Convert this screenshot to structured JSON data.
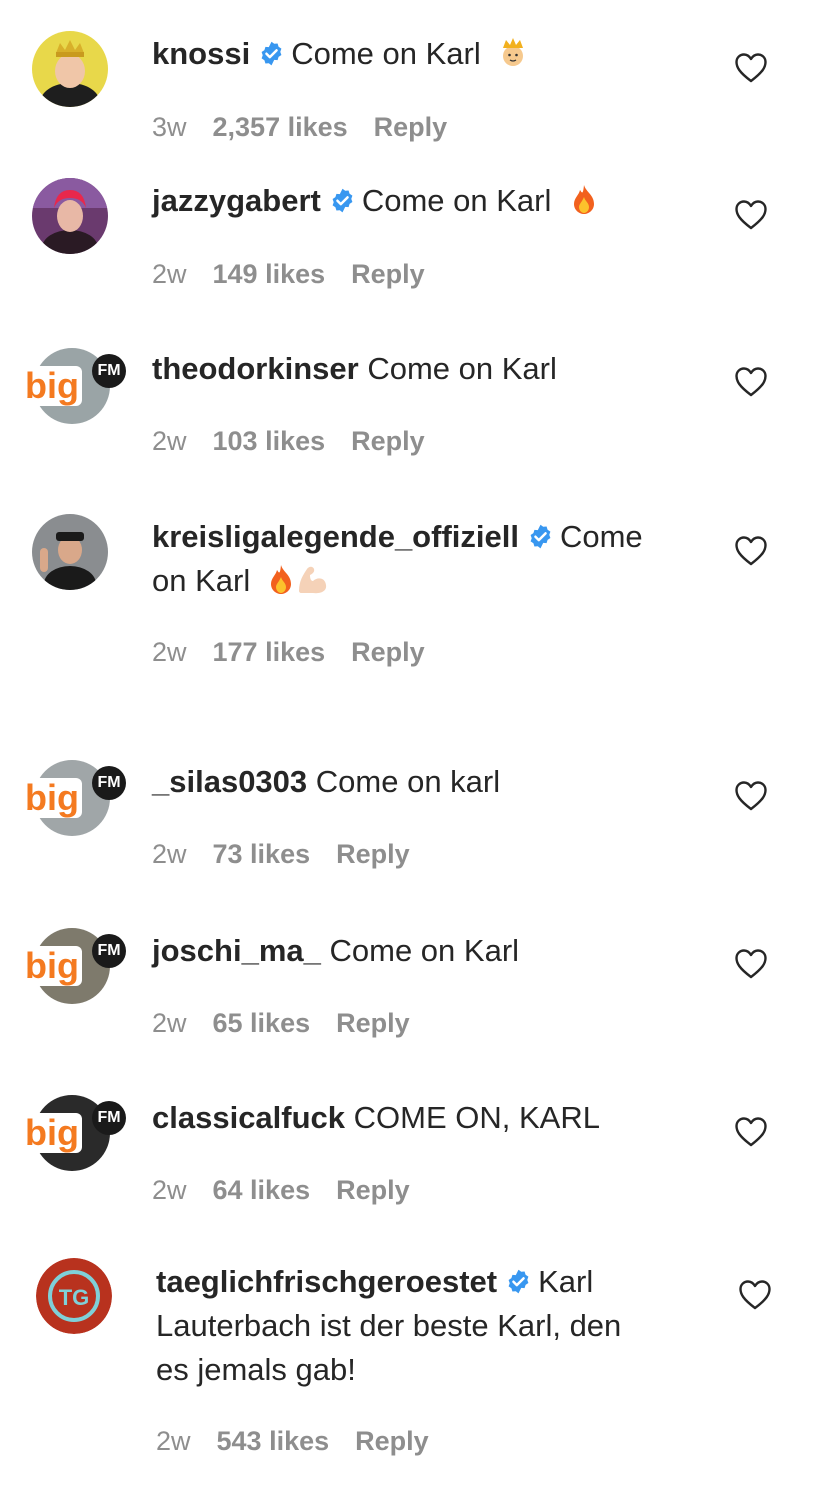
{
  "comments": [
    {
      "username": "knossi",
      "text": "Come on Karl",
      "age": "3w",
      "likes": "2,357 likes",
      "reply": "Reply",
      "verified": true,
      "emoji": "crown-face-emoji",
      "avatar": "avatar-knossi"
    },
    {
      "username": "jazzygabert",
      "text": "Come on Karl",
      "age": "2w",
      "likes": "149 likes",
      "reply": "Reply",
      "verified": true,
      "emoji": "fire-emoji",
      "avatar": "avatar-jazzygabert"
    },
    {
      "username": "theodorkinser",
      "text": "Come on Karl",
      "age": "2w",
      "likes": "103 likes",
      "reply": "Reply",
      "verified": false,
      "avatar": "avatar-bigfm"
    },
    {
      "username": "kreisligalegende_offiziell",
      "text_line1": "Come",
      "text_line2": "on Karl",
      "age": "2w",
      "likes": "177 likes",
      "reply": "Reply",
      "verified": true,
      "emoji": "fire-and-flexed-biceps-emoji",
      "avatar": "avatar-kreisligalegende"
    },
    {
      "username": "_silas0303",
      "text": "Come on karl",
      "age": "2w",
      "likes": "73 likes",
      "reply": "Reply",
      "verified": false,
      "avatar": "avatar-bigfm"
    },
    {
      "username": "joschi_ma_",
      "text": "Come on Karl",
      "age": "2w",
      "likes": "65 likes",
      "reply": "Reply",
      "verified": false,
      "avatar": "avatar-bigfm"
    },
    {
      "username": "classicalfuck",
      "text": "COME ON, KARL",
      "age": "2w",
      "likes": "64 likes",
      "reply": "Reply",
      "verified": false,
      "avatar": "avatar-bigfm"
    },
    {
      "username": "taeglichfrischgeroestet",
      "text_line1": "Karl",
      "text_line2": "Lauterbach ist der beste Karl, den",
      "text_line3": "es jemals gab!",
      "age": "2w",
      "likes": "543 likes",
      "reply": "Reply",
      "verified": true,
      "avatar": "avatar-tfg",
      "avatar_text": "TG"
    }
  ],
  "icons": {
    "like": "heart-outline-icon",
    "verified": "verified-badge-icon"
  },
  "bigfm_logo": {
    "big": "big",
    "fm": "FM"
  },
  "colors": {
    "verified": "#3897f0",
    "meta": "#8e8e8e",
    "text": "#262626",
    "bigfm_orange": "#f47a20"
  }
}
